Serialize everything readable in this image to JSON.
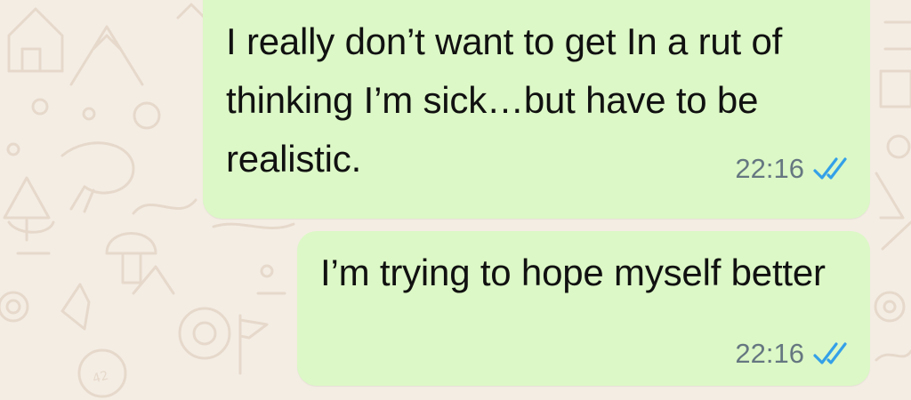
{
  "chat": {
    "wallpaper_color": "#f4ede4",
    "bubble_color": "#dcf8c6",
    "tick_color": "#34a0e8",
    "messages": [
      {
        "text": "I really don’t want to get In a rut of thinking I’m sick…but have to be realistic.",
        "time": "22:16",
        "status_icon": "double-check-read-icon"
      },
      {
        "text": "I’m trying to hope myself better",
        "time": "22:16",
        "status_icon": "double-check-read-icon"
      }
    ]
  }
}
